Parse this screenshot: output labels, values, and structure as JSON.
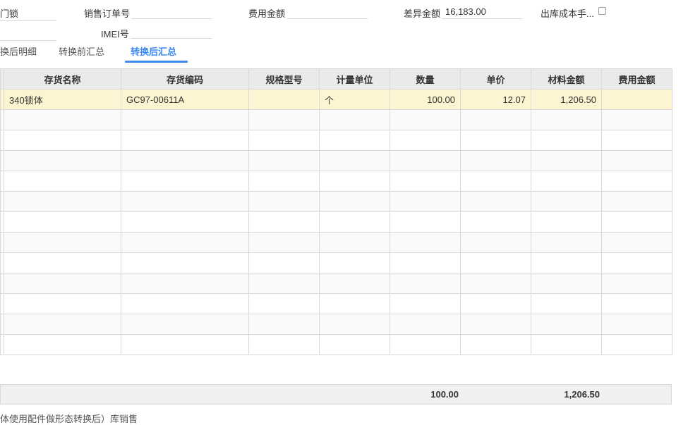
{
  "form": {
    "lock_label": "门锁",
    "sales_order_label": "销售订单号",
    "sales_order_value": "",
    "fee_amount_label": "费用金额",
    "fee_amount_value": "",
    "diff_amount_label": "差异金额",
    "diff_amount_value": "16,183.00",
    "outbound_cost_label": "出库成本手...",
    "imei_label": "IMEI号",
    "imei_value": ""
  },
  "tabs": [
    {
      "label": "换后明细"
    },
    {
      "label": "转换前汇总"
    },
    {
      "label": "转换后汇总",
      "active": true
    }
  ],
  "table": {
    "columns": [
      "存货名称",
      "存货编码",
      "规格型号",
      "计量单位",
      "数量",
      "单价",
      "材料金额",
      "费用金额"
    ],
    "rows": [
      {
        "name": "340锁体",
        "code": "GC97-00611A",
        "spec": "",
        "unit": "个",
        "qty": "100.00",
        "price": "12.07",
        "material": "1,206.50",
        "fee": ""
      }
    ]
  },
  "summary": {
    "qty_total": "100.00",
    "material_total": "1,206.50"
  },
  "footnote": "体使用配件做形态转换后）库销售"
}
